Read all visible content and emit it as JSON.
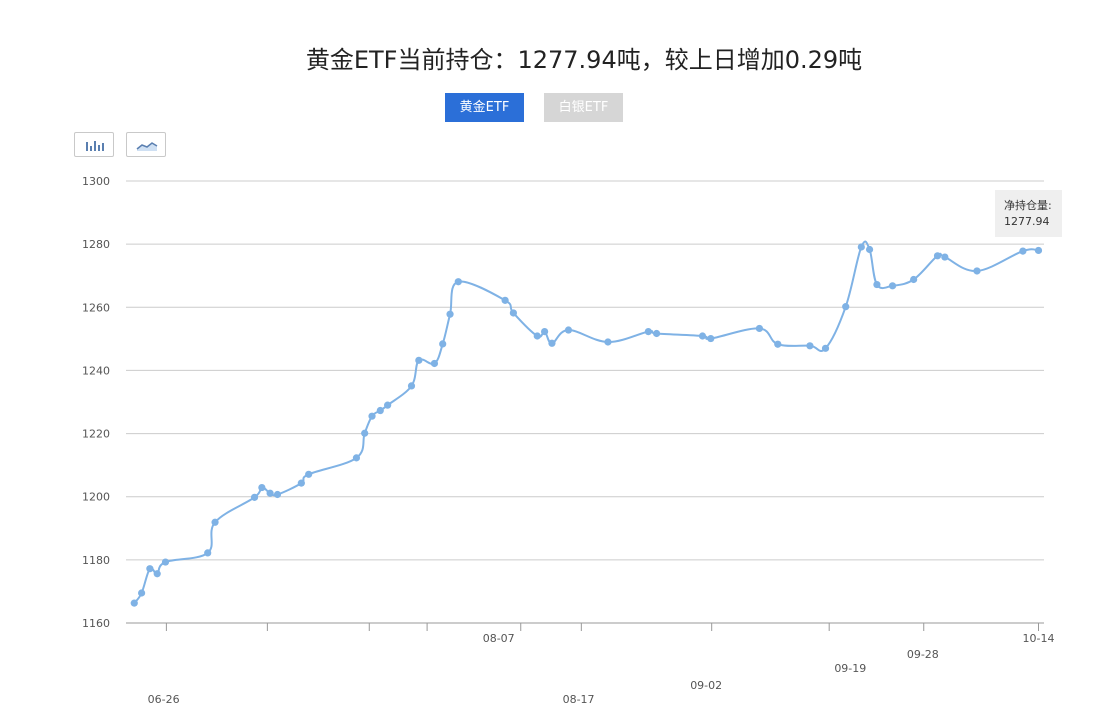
{
  "title": "黄金ETF当前持仓：1277.94吨，较上日增加0.29吨",
  "tabs": [
    {
      "label": "黄金ETF",
      "active": true
    },
    {
      "label": "白银ETF",
      "active": false
    }
  ],
  "toolbar": {
    "bar_icon": "bar-chart-icon",
    "line_icon": "line-chart-icon"
  },
  "tooltip": {
    "label": "净持仓量:",
    "value": "1277.94"
  },
  "colors": {
    "accent": "#2b6fd8",
    "line": "#7fb2e5",
    "grid": "#cccccc",
    "inactive_tab": "#d6d6d6"
  },
  "chart_data": {
    "type": "line",
    "title": "黄金ETF当前持仓：1277.94吨，较上日增加0.29吨",
    "ylim": [
      1160,
      1300
    ],
    "yticks": [
      1160,
      1180,
      1200,
      1220,
      1240,
      1260,
      1280,
      1300
    ],
    "xlim": [
      0,
      100
    ],
    "x_labels": [
      {
        "x": 4.1,
        "label": "06-26",
        "row": 3
      },
      {
        "x": 40.6,
        "label": "08-07",
        "row": 1
      },
      {
        "x": 49.3,
        "label": "08-17",
        "row": 3
      },
      {
        "x": 63.2,
        "label": "09-02",
        "row": 2
      },
      {
        "x": 78.9,
        "label": "09-19",
        "row": 1
      },
      {
        "x": 86.8,
        "label": "09-28",
        "row": 1
      },
      {
        "x": 99.4,
        "label": "10-14",
        "row": 0
      }
    ],
    "x_tick_marks": [
      4.4,
      15.4,
      26.5,
      32.8,
      43.0,
      49.6,
      63.8,
      76.6,
      86.9,
      99.4
    ],
    "series": [
      {
        "name": "",
        "x": [
          0.9,
          1.7,
          2.6,
          3.4,
          4.3,
          8.9,
          9.7,
          14.0,
          14.8,
          15.7,
          16.5,
          19.1,
          19.9,
          25.1,
          26.0,
          26.8,
          27.7,
          28.5,
          31.1,
          31.9,
          33.6,
          34.5,
          35.3,
          36.2,
          41.3,
          42.2,
          44.8,
          45.6,
          46.4,
          48.2,
          52.5,
          56.9,
          57.8,
          62.8,
          63.7,
          69.0,
          71.0,
          74.5,
          76.2,
          78.4,
          80.1,
          81.0,
          81.8,
          83.5,
          85.8,
          88.4,
          89.2,
          92.7,
          97.7,
          99.4
        ],
        "y": [
          1166.3,
          1169.5,
          1177.2,
          1175.6,
          1179.3,
          1182.2,
          1191.9,
          1199.8,
          1202.9,
          1201.1,
          1200.7,
          1204.3,
          1207.1,
          1212.3,
          1220.1,
          1225.5,
          1227.3,
          1229.0,
          1235.1,
          1243.2,
          1242.2,
          1248.4,
          1257.8,
          1268.1,
          1262.2,
          1258.2,
          1250.9,
          1252.3,
          1248.6,
          1252.8,
          1249.0,
          1252.3,
          1251.7,
          1250.9,
          1250.1,
          1253.3,
          1248.3,
          1247.8,
          1247.0,
          1260.2,
          1279.1,
          1278.3,
          1267.2,
          1266.8,
          1268.8,
          1276.3,
          1275.9,
          1271.5,
          1277.8,
          1278.0
        ]
      }
    ]
  }
}
